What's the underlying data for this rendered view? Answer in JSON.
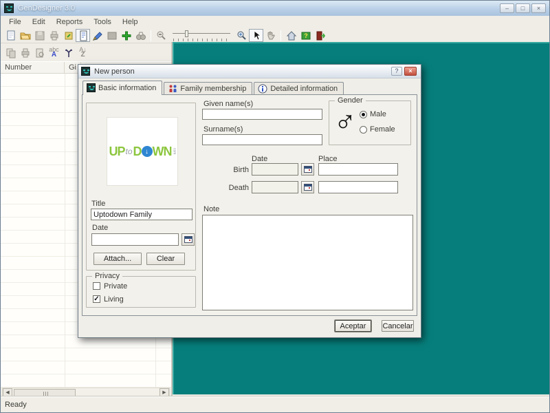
{
  "window": {
    "title": "GenDesigner 3.0",
    "buttons": {
      "minimize": "–",
      "maximize": "□",
      "close": "×"
    }
  },
  "menu": {
    "items": [
      "File",
      "Edit",
      "Reports",
      "Tools",
      "Help"
    ]
  },
  "toolbars": {
    "main": [
      "new-document",
      "open-file",
      "save",
      "print",
      "export",
      "report",
      "edit-pencil",
      "image",
      "add-person",
      "find-binoculars",
      "zoom-out",
      "zoom-slider",
      "zoom-in",
      "pointer-cursor",
      "pan-hand",
      "home",
      "help-book",
      "exit"
    ],
    "list": [
      "copy",
      "print",
      "page-preview",
      "spell-check",
      "tree-view",
      "sort-az"
    ]
  },
  "list_panel": {
    "columns": [
      "Number",
      "Gi"
    ]
  },
  "scrollbar": {
    "left_arrow": "◀",
    "right_arrow": "▶"
  },
  "status": {
    "text": "Ready"
  },
  "dialog": {
    "title": "New person",
    "help_glyph": "?",
    "close_glyph": "×",
    "tabs": [
      {
        "label": "Basic information",
        "active": true
      },
      {
        "label": "Family membership",
        "active": false
      },
      {
        "label": "Detailed information",
        "active": false
      }
    ],
    "media": {
      "logo": {
        "up": "UP",
        "to": "to",
        "d": "D",
        "arrow": "↓",
        "wn": "WN",
        "com": "com"
      },
      "title_label": "Title",
      "title_value": "Uptodown Family",
      "date_label": "Date",
      "date_value": "",
      "attach_button": "Attach...",
      "clear_button": "Clear"
    },
    "privacy": {
      "label": "Privacy",
      "options": [
        {
          "label": "Private",
          "checked": false
        },
        {
          "label": "Living",
          "checked": true
        }
      ]
    },
    "name_fields": [
      {
        "label": "Given name(s)",
        "value": ""
      },
      {
        "label": "Surname(s)",
        "value": ""
      }
    ],
    "gender": {
      "label": "Gender",
      "symbol": "♂",
      "options": [
        {
          "label": "Male",
          "selected": true
        },
        {
          "label": "Female",
          "selected": false
        }
      ]
    },
    "events": {
      "date_header": "Date",
      "place_header": "Place",
      "rows": [
        {
          "label": "Birth",
          "date": "",
          "place": ""
        },
        {
          "label": "Death",
          "date": "",
          "place": ""
        }
      ]
    },
    "note": {
      "label": "Note",
      "value": ""
    },
    "actions": {
      "ok": "Aceptar",
      "cancel": "Cancelar"
    }
  }
}
